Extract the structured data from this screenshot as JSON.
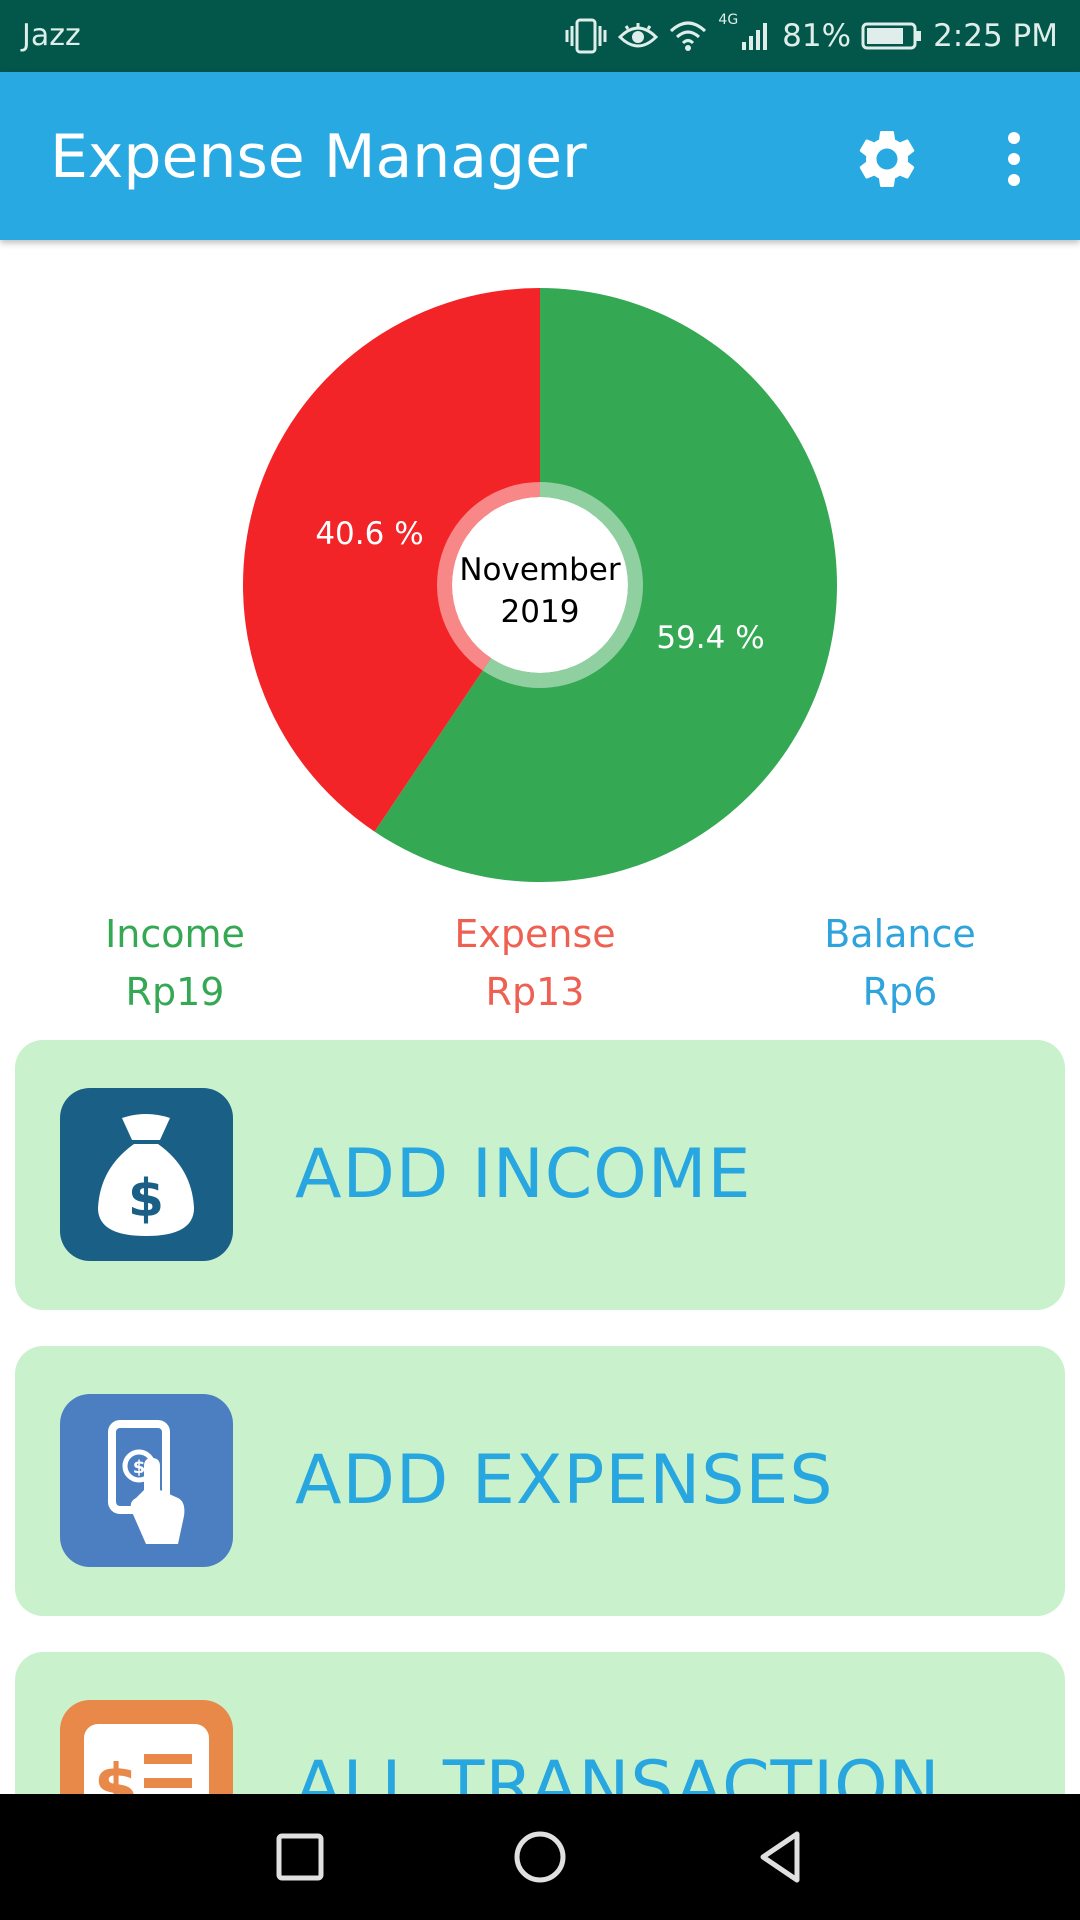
{
  "status_bar": {
    "carrier": "Jazz",
    "battery": "81%",
    "time": "2:25 PM",
    "network": "4G",
    "icons": [
      "vibrate-icon",
      "eye-icon",
      "wifi-icon",
      "signal-icon",
      "battery-icon"
    ]
  },
  "app_bar": {
    "title": "Expense Manager",
    "settings_icon": "gear-icon",
    "menu_icon": "more-vert-icon"
  },
  "chart": {
    "center_label_line1": "November",
    "center_label_line2": "2019",
    "colors": {
      "income": "#34a853",
      "expense": "#f22427"
    },
    "chart_data": {
      "type": "pie",
      "slices": [
        {
          "name": "Income",
          "value": 59.4,
          "label": "59.4 %",
          "color": "#34a853"
        },
        {
          "name": "Expense",
          "value": 40.6,
          "label": "40.6 %",
          "color": "#f22427"
        }
      ]
    }
  },
  "summary": {
    "income": {
      "label": "Income",
      "value": "Rp19",
      "color": "#34a853"
    },
    "expense": {
      "label": "Expense",
      "value": "Rp13",
      "color": "#ee6052"
    },
    "balance": {
      "label": "Balance",
      "value": "Rp6",
      "color": "#2ea3dc"
    }
  },
  "actions": [
    {
      "label": "ADD INCOME",
      "icon": "money-bag-icon"
    },
    {
      "label": "ADD EXPENSES",
      "icon": "hand-payment-icon"
    },
    {
      "label": "ALL TRANSACTION",
      "icon": "transaction-list-icon"
    }
  ],
  "nav_bar": {
    "icons": [
      "recents-square-icon",
      "home-circle-icon",
      "back-triangle-icon"
    ]
  }
}
